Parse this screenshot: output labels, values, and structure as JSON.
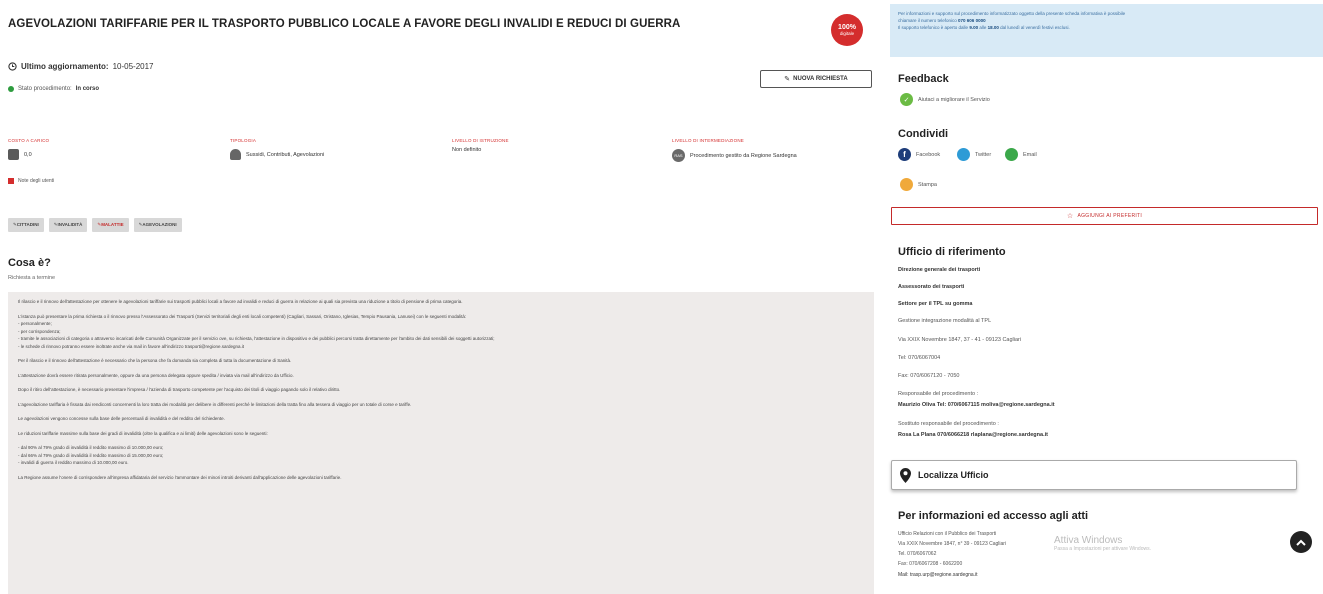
{
  "page": {
    "title": "AGEVOLAZIONI TARIFFARIE PER IL TRASPORTO PUBBLICO LOCALE A FAVORE DEGLI INVALIDI E REDUCI DI GUERRA",
    "badge_main": "100%",
    "badge_sub": "digitale",
    "update_label": "Ultimo aggiornamento:",
    "update_value": "10-05-2017",
    "status_label": "Stato procedimento:",
    "status_value": "In corso",
    "new_request_label": "NUOVA RICHIESTA",
    "status_color": "#2e9c3f",
    "accent_color": "#d42d2d"
  },
  "meta": [
    {
      "label": "COSTO A CARICO",
      "value": "0,0",
      "icon": "euro-icon"
    },
    {
      "label": "TIPOLOGIA",
      "value": "Sussidi, Contributi, Agevolazioni",
      "icon": "user-icon"
    },
    {
      "label": "LIVELLO DI ISTRUZIONE",
      "value": "Non definito",
      "icon": ""
    },
    {
      "label": "LIVELLO DI INTERMEDIAZIONE",
      "value": "Procedimento gestito da Regione Sardegna",
      "icon": "ras-icon"
    }
  ],
  "legend_text": "Note degli utenti",
  "tags": [
    {
      "label": "CITTADINI",
      "style": "normal"
    },
    {
      "label": "INVALIDITÀ",
      "style": "normal"
    },
    {
      "label": "MALATTIE",
      "style": "red"
    },
    {
      "label": "AGEVOLAZIONI",
      "style": "normal"
    }
  ],
  "cosa": {
    "title": "Cosa è?",
    "subtitle": "Richiesta a termine"
  },
  "body_paragraphs": [
    "Il rilascio e il rinnovo dell'attestazione per ottenere le agevolazioni tariffarie sui trasporti pubblici locali a favore ad invalidi e reduci di guerra in relazione ai quali sia prevista una riduzione a titolo di pensione di prima categoria.",
    "L'istanza può presentare la prima richiesta o il rinnovo presso l'Assessorato dei Trasporti (Servizi territoriali degli enti locali competenti) (Cagliari, Sassari, Oristano, Iglesias, Tempio Pausania, Lanusei) con le seguenti modalità:\n- personalmente;\n- per corrispondenza;\n- tramite le associazioni di categoria o attraverso incaricati delle Comunità Organizzate per il servizio ove, su richiesta, l'attestazione in dispositivo e dei pubblici percorsi tratta direttamente per l'ambito dei dati sensibili dei soggetti autorizzati;\n- le schede di rinnovo potranno essere inoltrate anche via mail in favore all'indirizzo trasporti@regione.sardegna.it",
    "Per il rilascio e il rinnovo dell'attestazione è necessario che la persona che fa domanda sia completa di tutta la documentazione di Sanità.",
    "L'attestazione dovrà essere ritirata personalmente, oppure da una persona delegata oppure spedita / inviata via mail all'indirizzo da Ufficio.",
    "Dopo il ritiro dell'attestazione, è necessario presentare l'impresa / l'azienda di trasporto competente per l'acquisto dei titoli di viaggio pagando solo il relativo diritto.",
    "L'agevolazione tariffaria è fissata dai rendiconti concernenti la loro tratta dei modalità per delibere in differenti perché le limitazioni della tratta fino alla tessera di viaggio per un totale di corse e tariffe.",
    "Le agevolazioni vengono concesse sulla base delle percentuali di invalidità e del reddito del richiedente.",
    "Le riduzioni tariffarie massime sulla base dei gradi di invalidità (oltre la qualifica e ai limiti) delle agevolazioni sono le seguenti:",
    "- dal 90% al 79% grado di invalidità il reddito massimo di 10.000,00 euro;\n- dal 66% al 79% grado di invalidità il reddito massimo di 15.000,00 euro;\n- invalidi di guerra il reddito massimo di 10.000,00 euro.",
    "La Regione assume l'onere di corrispondere all'impresa affidataria del servizio l'ammontare dei minori introiti derivanti dall'applicazione delle agevolazioni tariffarie."
  ],
  "info_box": {
    "line1": "Per informazioni e supporto sul procedimento informatizzato oggetto della presente scheda informativa è possibile",
    "line2_pre": "chiamare il numero telefonico",
    "line2_num": "070 606 0000",
    "line3_pre": "Il supporto telefonico è aperto dalle",
    "line3_h1": "9.00",
    "line3_mid": "alle",
    "line3_h2": "18.00",
    "line3_post": "dal lunedì al venerdì festivi esclusi."
  },
  "feedback": {
    "title": "Feedback",
    "text": "Aiutaci a migliorare il Servizio"
  },
  "share": {
    "title": "Condividi",
    "facebook": "Facebook",
    "twitter": "Twitter",
    "email": "Email",
    "print": "Stampa"
  },
  "favorites_label": "AGGIUNGI AI PREFERITI",
  "ufficio": {
    "title": "Ufficio di riferimento",
    "lines": [
      {
        "text": "Direzione generale dei trasporti",
        "bold": true
      },
      {
        "text": "Assessorato dei trasporti",
        "bold": true
      },
      {
        "text": "Settore per il TPL su gomma",
        "bold": true
      },
      {
        "text": "Gestione integrazione modalità al TPL",
        "bold": false
      },
      {
        "text": "Via XXIX Novembre 1847, 37 - 41 - 09123 Cagliari",
        "bold": false
      },
      {
        "text": "Tel: 070/6067004",
        "bold": false
      },
      {
        "text": "Fax: 070/6067120 - 7050",
        "bold": false
      },
      {
        "text": "Responsabile del procedimento :",
        "bold": false
      },
      {
        "text": "Maurizio Oliva Tel: 070/6067115 moliva@regione.sardegna.it",
        "bold": true
      },
      {
        "text": "Sostituto responsabile del procedimento :",
        "bold": false
      },
      {
        "text": "Rosa La Plana 070/6066218 rlaplana@regione.sardegna.it",
        "bold": true
      }
    ]
  },
  "localizza": "Localizza Ufficio",
  "accesso": {
    "title": "Per informazioni ed accesso agli atti",
    "lines": [
      "Ufficio Relazioni con il Pubblico dei Trasporti",
      "Via XXIX Novembre 1847, n° 39 - 09123 Cagliari",
      "Tel. 070/6067062",
      "Fax: 070/6067208 - 6062200",
      "Mail: trasp.urp@regione.sardegna.it"
    ]
  },
  "windows_mark": {
    "title": "Attiva Windows",
    "sub": "Passa a Impostazioni per attivare Windows."
  }
}
